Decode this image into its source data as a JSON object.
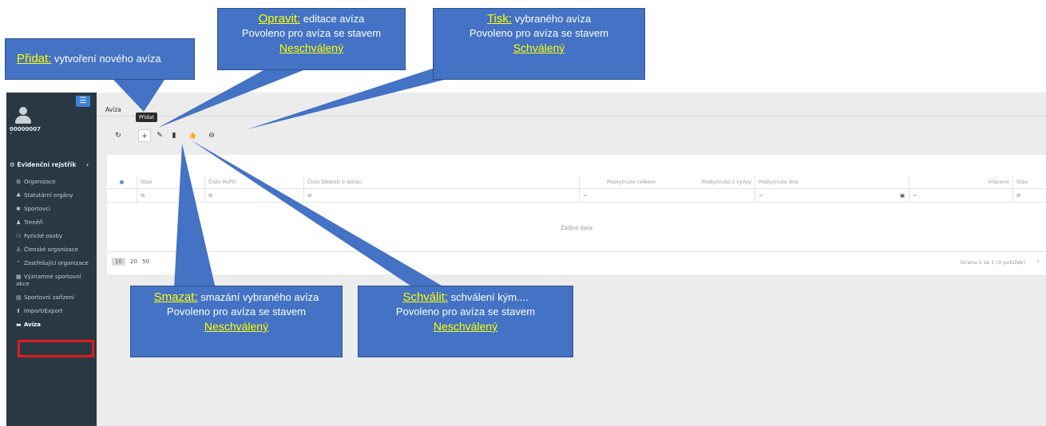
{
  "sidebar": {
    "user_id": "00000007",
    "user_caret": "˅",
    "menu_icon": "☰",
    "section": "Evidenční rejstřík",
    "section_arrow": "‹",
    "items": [
      {
        "icon": "⚙",
        "label": "Organizace"
      },
      {
        "icon": "♣",
        "label": "Statutární orgány"
      },
      {
        "icon": "✱",
        "label": "Sportovci"
      },
      {
        "icon": "♟",
        "label": "Trenéři"
      },
      {
        "icon": "⚇",
        "label": "Fyzické osoby"
      },
      {
        "icon": "♙",
        "label": "Členské organizace"
      },
      {
        "icon": "⌃",
        "label": "Zastřešující organizace"
      },
      {
        "icon": "▦",
        "label": "Významné sportovní akce"
      },
      {
        "icon": "▤",
        "label": "Sportovní zařízení"
      },
      {
        "icon": "⬆",
        "label": "Import/Export"
      },
      {
        "icon": "▬",
        "label": "Avíza"
      }
    ]
  },
  "main": {
    "breadcrumb": "Avíza",
    "tooltip": "Přidat",
    "toolbar": {
      "refresh": "↻",
      "add": "+",
      "edit": "✎",
      "delete": "▮",
      "approve": "👍",
      "print": "⊖"
    },
    "table": {
      "headers": [
        "Stav",
        "Číslo RoPD",
        "Číslo žádosti o dotaci",
        "Poskytnuto celkem",
        "Poskytnuto z výzvy",
        "Poskytnuto dne",
        "Vráceno",
        "Stav"
      ],
      "filters": [
        "⊞",
        "⊞",
        "⊞",
        "=",
        "=",
        ">",
        "=",
        "⊞"
      ],
      "empty": "Žádná data"
    },
    "pager": {
      "sizes": [
        "10",
        "20",
        "50"
      ],
      "info": "Strana 1 ze 1 (0 položek)",
      "prev": "‹"
    }
  },
  "callouts": {
    "pridat": {
      "key": "Přidat:",
      "text": " vytvoření nového avíza"
    },
    "opravit": {
      "key": "Opravit:",
      "text": " editace avíza",
      "line2": "Povoleno pro avíza se stavem",
      "state": "Neschválený"
    },
    "tisk": {
      "key": "Tisk:",
      "text": " vybraného avíza",
      "line2": "Povoleno pro avíza se stavem",
      "state": "Schválený"
    },
    "smazat": {
      "key": "Smazat:",
      "text": " smazání vybraného avíza",
      "line2": "Povoleno pro avíza se stavem",
      "state": "Neschválený"
    },
    "schvalit": {
      "key": "Schválit:",
      "text": " schválení kým....",
      "line2": "Povoleno pro avíza se stavem",
      "state": "Neschválený"
    }
  },
  "colors": {
    "callout_fill": "#4472c4",
    "callout_key": "#ffff00",
    "sidebar_bg": "#2a3844",
    "highlight": "#e21b1b"
  }
}
